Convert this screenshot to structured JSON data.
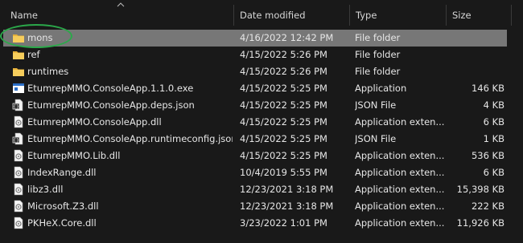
{
  "columns": {
    "name": "Name",
    "date_modified": "Date modified",
    "type": "Type",
    "size": "Size"
  },
  "files": [
    {
      "name": "mons",
      "date": "4/16/2022 12:42 PM",
      "type": "File folder",
      "size": "",
      "icon": "folder-icon",
      "selected": true
    },
    {
      "name": "ref",
      "date": "4/15/2022 5:26 PM",
      "type": "File folder",
      "size": "",
      "icon": "folder-icon",
      "selected": false
    },
    {
      "name": "runtimes",
      "date": "4/15/2022 5:26 PM",
      "type": "File folder",
      "size": "",
      "icon": "folder-icon",
      "selected": false
    },
    {
      "name": "EtumrepMMO.ConsoleApp.1.1.0.exe",
      "date": "4/15/2022 5:25 PM",
      "type": "Application",
      "size": "146 KB",
      "icon": "exe-icon",
      "selected": false
    },
    {
      "name": "EtumrepMMO.ConsoleApp.deps.json",
      "date": "4/15/2022 5:25 PM",
      "type": "JSON File",
      "size": "4 KB",
      "icon": "json-icon",
      "selected": false
    },
    {
      "name": "EtumrepMMO.ConsoleApp.dll",
      "date": "4/15/2022 5:25 PM",
      "type": "Application exten...",
      "size": "6 KB",
      "icon": "dll-icon",
      "selected": false
    },
    {
      "name": "EtumrepMMO.ConsoleApp.runtimeconfig.json",
      "date": "4/15/2022 5:25 PM",
      "type": "JSON File",
      "size": "1 KB",
      "icon": "json-icon",
      "selected": false
    },
    {
      "name": "EtumrepMMO.Lib.dll",
      "date": "4/15/2022 5:25 PM",
      "type": "Application exten...",
      "size": "536 KB",
      "icon": "dll-icon",
      "selected": false
    },
    {
      "name": "IndexRange.dll",
      "date": "10/4/2019 5:55 PM",
      "type": "Application exten...",
      "size": "6 KB",
      "icon": "dll-icon",
      "selected": false
    },
    {
      "name": "libz3.dll",
      "date": "12/23/2021 3:18 PM",
      "type": "Application exten...",
      "size": "15,398 KB",
      "icon": "dll-icon",
      "selected": false
    },
    {
      "name": "Microsoft.Z3.dll",
      "date": "12/23/2021 3:18 PM",
      "type": "Application exten...",
      "size": "222 KB",
      "icon": "dll-icon",
      "selected": false
    },
    {
      "name": "PKHeX.Core.dll",
      "date": "3/23/2022 1:01 PM",
      "type": "Application exten...",
      "size": "11,926 KB",
      "icon": "dll-icon",
      "selected": false
    }
  ],
  "colors": {
    "background": "#191919",
    "selected_row": "#777777",
    "highlight_ring": "#2ba84a",
    "folder": "#f2c14e"
  }
}
